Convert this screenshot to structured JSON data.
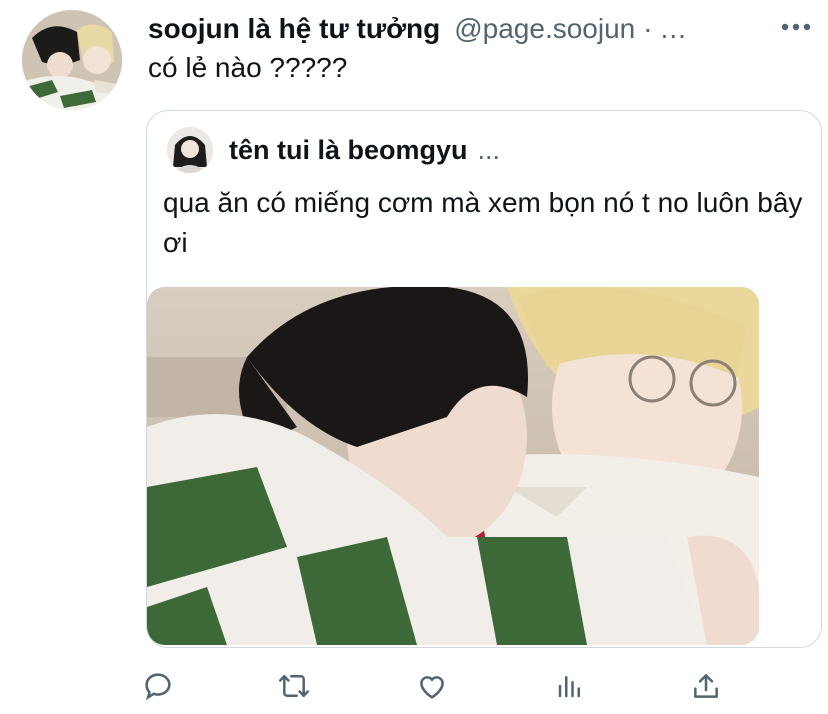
{
  "tweet": {
    "display_name": "soojun là hệ tư tưởng",
    "handle": "@page.soojun",
    "separator": "·",
    "overflow": "...",
    "text": "có lẻ nào ?????"
  },
  "quoted": {
    "display_name": "tên tui là beomgyu",
    "overflow": "...",
    "text": "qua ăn có miếng cơm mà xem bọn nó t no luôn bây ơi"
  },
  "actions": {
    "reply_icon": "reply-icon",
    "retweet_icon": "retweet-icon",
    "like_icon": "heart-icon",
    "views_icon": "analytics-icon",
    "share_icon": "share-icon"
  },
  "colors": {
    "text": "#0f1419",
    "secondary": "#536471",
    "border": "#cfd9de"
  }
}
